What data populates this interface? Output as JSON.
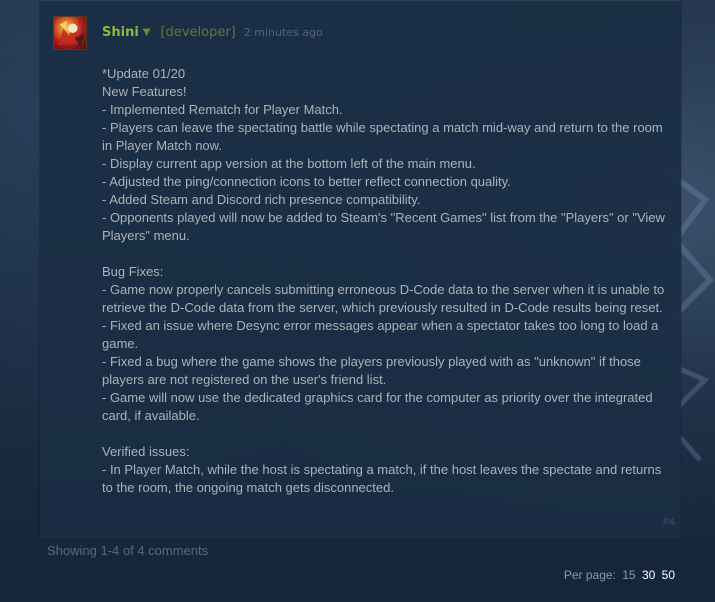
{
  "comment": {
    "author": "Shini",
    "role": "[developer]",
    "timestamp": "2 minutes ago",
    "index": "#4",
    "body_lines": [
      "*Update 01/20",
      "New Features!",
      "- Implemented Rematch for Player Match.",
      "- Players can leave the spectating battle while spectating a match mid-way and return to the room in Player Match now.",
      "- Display current app version at the bottom left of the main menu.",
      "- Adjusted the ping/connection icons to better reflect connection quality.",
      "- Added Steam and Discord rich presence compatibility.",
      "- Opponents played will now be added to Steam's \"Recent Games\" list from the \"Players\" or \"View Players\" menu.",
      "",
      "Bug Fixes:",
      "- Game now properly cancels submitting erroneous D-Code data to the server when it is unable to retrieve the D-Code data from the server, which previously resulted in D-Code results being reset.",
      "- Fixed an issue where Desync error messages appear when a spectator takes too long to load a game.",
      "- Fixed a bug where the game shows the players previously played with as \"unknown\" if those players are not registered on the user's friend list.",
      "- Game will now use the dedicated graphics card for the computer as priority over the integrated card, if available.",
      "",
      "Verified issues:",
      "- In Player Match, while the host is spectating a match, if the host leaves the spectate and returns to the room, the ongoing match gets disconnected."
    ]
  },
  "footer": {
    "showing": "Showing 1-4 of 4 comments"
  },
  "pagination": {
    "label": "Per page:",
    "options": [
      "15",
      "30",
      "50"
    ],
    "selected": [
      "30",
      "50"
    ]
  },
  "icons": {
    "avatar": "avatar-image",
    "author_menu": "chevron-down-icon"
  },
  "colors": {
    "author": "#90ba3c",
    "role": "#61783a",
    "text": "#acb2b8",
    "background": "#1b2838"
  }
}
